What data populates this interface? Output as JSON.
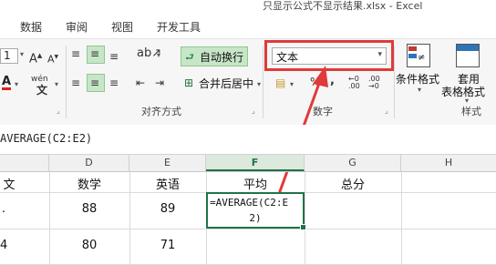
{
  "window": {
    "title": "只显示公式不显示结果.xlsx - Excel"
  },
  "tabs": [
    "数据",
    "审阅",
    "视图",
    "开发工具"
  ],
  "ribbon": {
    "font_size_value": "1",
    "grow_font": "A",
    "shrink_font": "A",
    "font_color_letter": "A",
    "phonetic_label": "wén",
    "wrap_text_label": "自动换行",
    "merge_center_label": "合并后居中",
    "number_format_value": "文本",
    "percent_symbol": "%",
    "comma_symbol": ",",
    "conditional_format_label": "条件格式",
    "table_format_label_1": "套用",
    "table_format_label_2": "表格格式",
    "group_labels": {
      "alignment": "对齐方式",
      "number": "数字",
      "styles": "样式"
    },
    "colors": {
      "highlight_fill": "#c7e6c7",
      "callout_red": "#e03a3a",
      "accent_green": "#217346"
    }
  },
  "formula_bar": {
    "text": "AVERAGE(C2:E2)"
  },
  "sheet": {
    "columns": [
      {
        "label": "",
        "active": false
      },
      {
        "label": "D",
        "active": false
      },
      {
        "label": "E",
        "active": false
      },
      {
        "label": "F",
        "active": true
      },
      {
        "label": "G",
        "active": false
      },
      {
        "label": "H",
        "active": false
      }
    ],
    "rows": [
      [
        "文",
        "数学",
        "英语",
        "平均",
        "总分"
      ],
      [
        "",
        "88",
        "89",
        "=AVERAGE(C2:E2)",
        ""
      ],
      [
        "",
        "80",
        "71",
        "",
        ""
      ]
    ],
    "active_cell_line1": "=AVERAGE(C2:E",
    "active_cell_line2": "2)"
  }
}
